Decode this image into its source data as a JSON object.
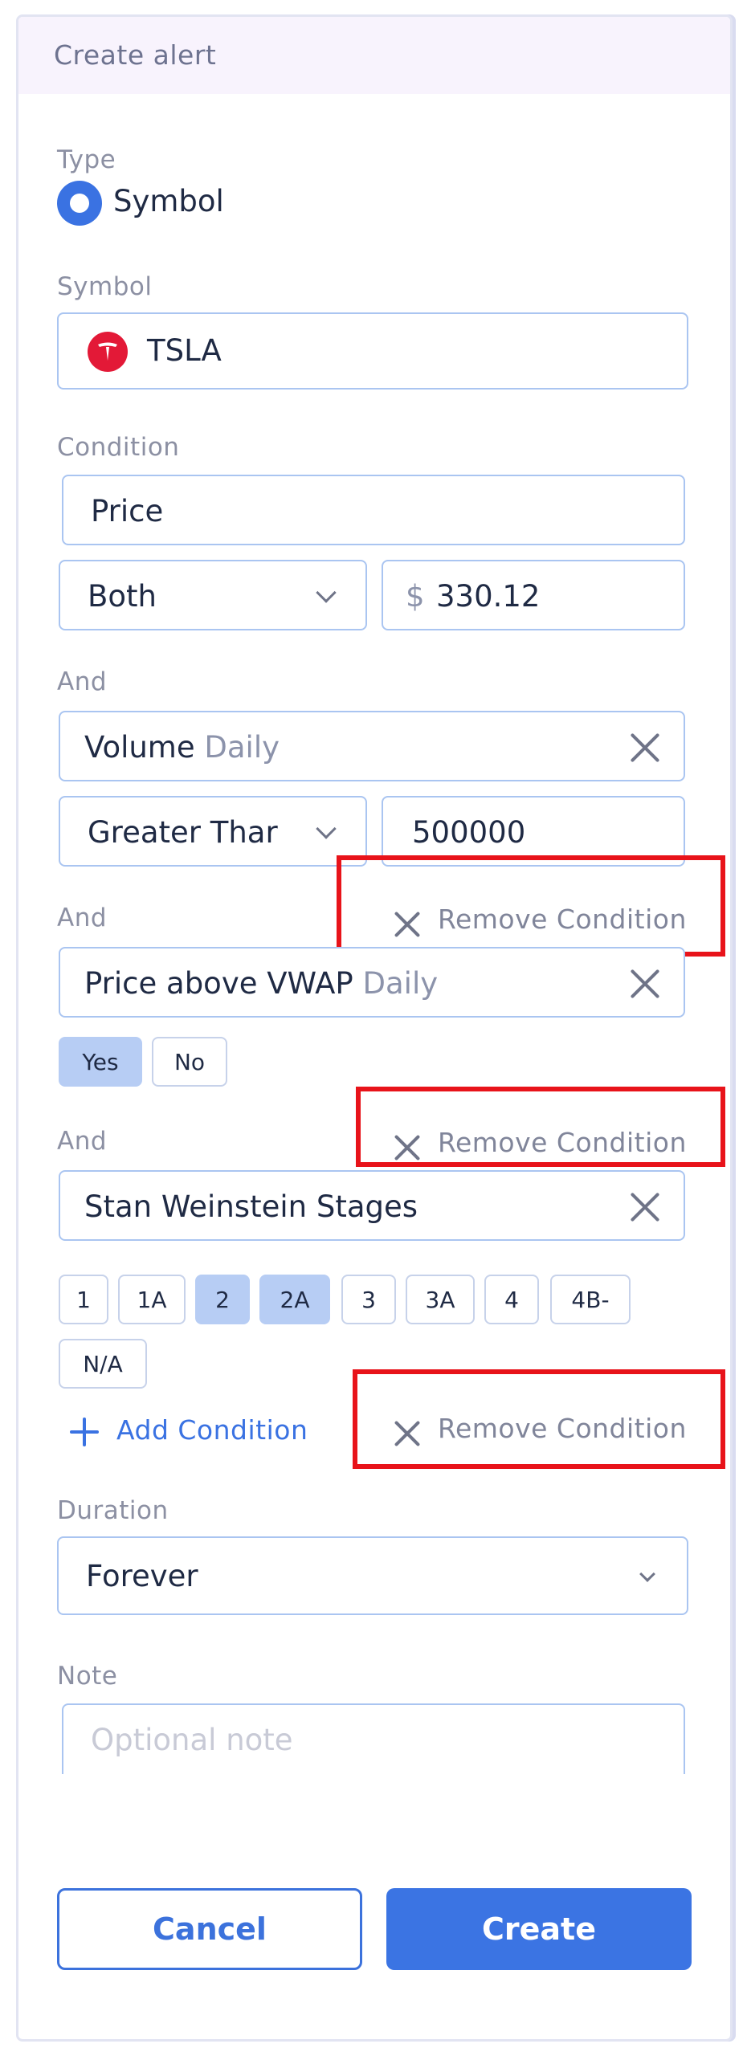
{
  "header": {
    "title": "Create alert"
  },
  "type_section": {
    "label": "Type",
    "option_label": "Symbol"
  },
  "symbol_section": {
    "label": "Symbol",
    "value": "TSLA"
  },
  "condition_section": {
    "label": "Condition",
    "field_value": "Price",
    "direction_value": "Both",
    "currency_symbol": "$",
    "price_value": "330.12"
  },
  "and_label": "And",
  "volume_condition": {
    "name": "Volume",
    "timeframe": "Daily",
    "operator_value": "Greater Thar",
    "amount_value": "500000"
  },
  "vwap_condition": {
    "name": "Price above VWAP",
    "timeframe": "Daily",
    "yes_label": "Yes",
    "no_label": "No",
    "selected": "Yes"
  },
  "stages_condition": {
    "name": "Stan Weinstein Stages",
    "options": [
      "1",
      "1A",
      "2",
      "2A",
      "3",
      "3A",
      "4",
      "4B-",
      "N/A"
    ],
    "selected": [
      "2",
      "2A"
    ]
  },
  "remove_condition_label": "Remove Condition",
  "add_condition_label": "Add Condition",
  "duration_section": {
    "label": "Duration",
    "value": "Forever"
  },
  "note_section": {
    "label": "Note",
    "placeholder": "Optional note"
  },
  "actions": {
    "cancel_label": "Cancel",
    "create_label": "Create"
  },
  "colors": {
    "accent": "#3B74E3",
    "highlight": "#E8131A",
    "selected_chip": "#B7CDF4"
  }
}
